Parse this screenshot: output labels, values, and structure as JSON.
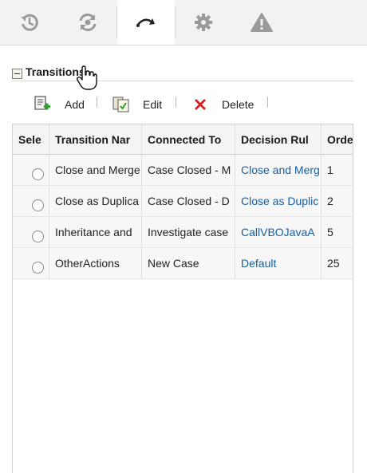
{
  "toolbar": {
    "buttons": [
      {
        "icon": "history-icon",
        "active": false
      },
      {
        "icon": "sync-icon",
        "active": false
      },
      {
        "icon": "transition-arrow-icon",
        "active": true
      },
      {
        "icon": "gear-icon",
        "active": false
      },
      {
        "icon": "warning-icon",
        "active": false
      }
    ],
    "icon_color": "#9a9a9a",
    "active_icon_color": "#222222"
  },
  "section": {
    "title": "Transitions"
  },
  "actions": {
    "add_label": "Add",
    "edit_label": "Edit",
    "delete_label": "Delete"
  },
  "table": {
    "columns": [
      "Sele",
      "Transition Nar",
      "Connected To",
      "Decision Rul",
      "Orde"
    ],
    "rows": [
      {
        "transition_name": "Close and Merge",
        "connected_to": "Case Closed - M",
        "decision_rule": "Close and Merg",
        "order": "1"
      },
      {
        "transition_name": "Close as Duplica",
        "connected_to": "Case Closed - D",
        "decision_rule": "Close as Duplic",
        "order": "2"
      },
      {
        "transition_name": "Inheritance and",
        "connected_to": "Investigate case",
        "decision_rule": "CallVBOJavaA",
        "order": "5"
      },
      {
        "transition_name": "OtherActions",
        "connected_to": "New Case",
        "decision_rule": "Default",
        "order": "25"
      }
    ]
  },
  "colors": {
    "link": "#155fa0",
    "delete_red": "#d42020",
    "add_green": "#2e9e2e"
  }
}
